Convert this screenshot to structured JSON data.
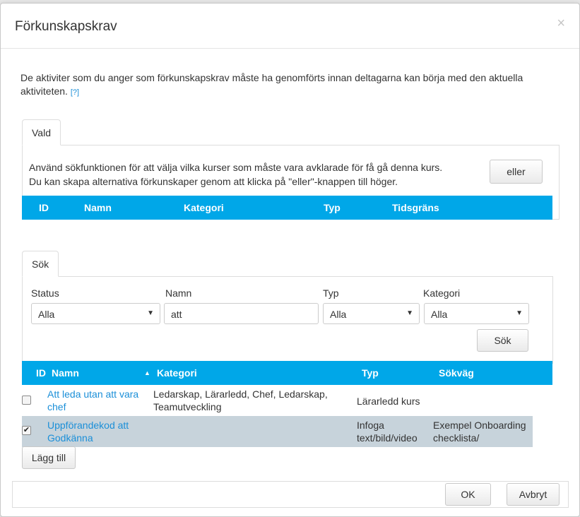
{
  "dialog": {
    "title": "Förkunskapskrav",
    "close_glyph": "×",
    "intro_text": "De aktiviter som du anger som förkunskapskrav måste ha genomförts innan deltagarna kan börja med den aktuella aktiviteten.",
    "help_link": "[?]"
  },
  "selected_tab": {
    "label": "Vald",
    "description_line1": "Använd sökfunktionen för att välja vilka kurser som måste vara avklarade för få gå denna kurs.",
    "description_line2": "Du kan skapa alternativa förkunskaper genom att klicka på \"eller\"-knappen till höger.",
    "or_button": "eller",
    "columns": {
      "id": "ID",
      "name": "Namn",
      "category": "Kategori",
      "type": "Typ",
      "deadline": "Tidsgräns"
    }
  },
  "search_tab": {
    "label": "Sök",
    "status_label": "Status",
    "status_value": "Alla",
    "name_label": "Namn",
    "name_value": "att",
    "type_label": "Typ",
    "type_value": "Alla",
    "category_label": "Kategori",
    "category_value": "Alla",
    "search_button": "Sök",
    "columns": {
      "id": "ID",
      "name": "Namn",
      "sort_glyph": "▲",
      "category": "Kategori",
      "type": "Typ",
      "path": "Sökväg"
    },
    "rows": [
      {
        "checked": false,
        "name_line1": "Att leda utan att vara",
        "name_line2": "chef",
        "category_line1": "Ledarskap, Lärarledd, Chef, Ledarskap,",
        "category_line2": "Teamutveckling",
        "type_line1": "Lärarledd kurs",
        "type_line2": "",
        "path_line1": "",
        "path_line2": ""
      },
      {
        "checked": true,
        "name_line1": "Uppförandekod att",
        "name_line2": "Godkänna",
        "category_line1": "",
        "category_line2": "",
        "type_line1": "Infoga",
        "type_line2": "text/bild/video",
        "path_line1": "Exempel Onboarding",
        "path_line2": "checklista/"
      }
    ],
    "add_button": "Lägg till"
  },
  "footer": {
    "ok_button": "OK",
    "cancel_button": "Avbryt"
  },
  "colors": {
    "header_blue": "#00a7e8",
    "link_blue": "#1b8fd8",
    "selected_row": "#c7d3db"
  }
}
